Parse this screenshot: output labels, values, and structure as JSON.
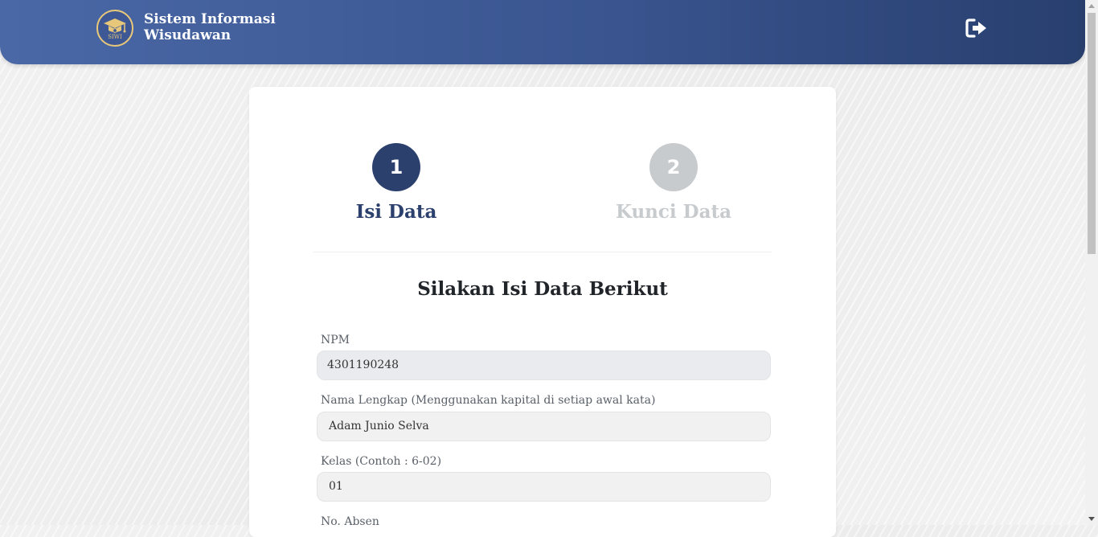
{
  "header": {
    "logo_text": "SIWI",
    "brand_line1": "Sistem Informasi",
    "brand_line2": "Wisudawan",
    "logout_icon": "sign-out-icon"
  },
  "steps": [
    {
      "number": "1",
      "label": "Isi Data",
      "state": "active",
      "color": "#2b406d"
    },
    {
      "number": "2",
      "label": "Kunci Data",
      "state": "inactive",
      "color": "#c8cbce"
    }
  ],
  "form": {
    "title": "Silakan Isi Data Berikut",
    "fields": [
      {
        "label": "NPM",
        "value": "4301190248"
      },
      {
        "label": "Nama Lengkap (Menggunakan kapital di setiap awal kata)",
        "value": "Adam Junio Selva"
      },
      {
        "label": "Kelas (Contoh : 6-02)",
        "value": "01"
      },
      {
        "label": "No. Absen",
        "value": ""
      }
    ]
  }
}
